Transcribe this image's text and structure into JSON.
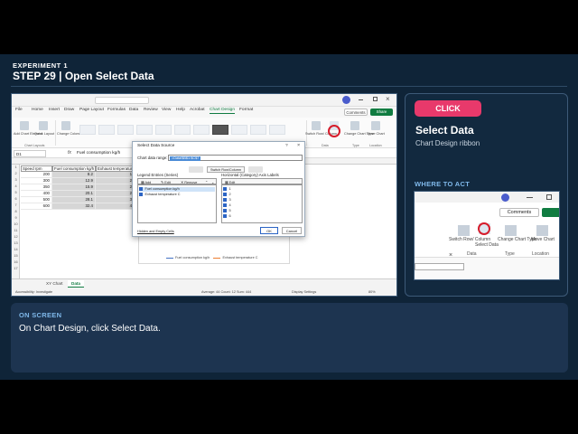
{
  "header": {
    "experiment": "EXPERIMENT 1",
    "step": "STEP 29  |  Open Select Data"
  },
  "excel": {
    "menus": [
      "File",
      "Home",
      "Insert",
      "Draw",
      "Page Layout",
      "Formulas",
      "Data",
      "Review",
      "View",
      "Help",
      "Acrobat",
      "Chart Design",
      "Format"
    ],
    "active_menu": "Chart Design",
    "comments": "Comments",
    "share": "Share",
    "ribbon": {
      "add_chart_element": "Add Chart Element",
      "quick_layout": "Quick Layout",
      "change_colors": "Change Colors",
      "switch_row_column": "Switch Row/ Column",
      "select_data": "Select Data",
      "change_chart_type": "Change Chart Type",
      "move_chart": "Move Chart",
      "group_chart_layouts": "Chart Layouts",
      "group_data": "Data",
      "group_type": "Type",
      "group_location": "Location"
    },
    "name_box": "D1",
    "formula": "Fuel consumption kg/h",
    "columns": [
      "Speed rpm",
      "Fuel consumption kg/h",
      "Exhaust temperature C"
    ],
    "rows": [
      [
        "200",
        "8.2",
        "190"
      ],
      [
        "300",
        "12.9",
        "235"
      ],
      [
        "350",
        "15.9",
        "255"
      ],
      [
        "400",
        "20.1",
        "280"
      ],
      [
        "500",
        "28.1",
        "330"
      ],
      [
        "600",
        "32.4",
        "400"
      ]
    ],
    "legend": [
      "Fuel consumption kg/h",
      "Exhaust temperature C"
    ],
    "sheet_tabs": [
      "XY Chart",
      "Data"
    ],
    "active_sheet": "Data",
    "status": {
      "accessibility": "Accessibility: Investigate",
      "average": "Average: 44  Count: 12  Sum: 444",
      "display": "Display Settings",
      "zoom": "80%"
    }
  },
  "dialog": {
    "title": "Select Data Source",
    "chart_range_label": "Chart data range:",
    "chart_range_value": "=Data!$B$1:$C$7",
    "switch_label": "Switch Row/Column",
    "legend_label": "Legend Entries (Series)",
    "axis_label": "Horizontal (Category) Axis Labels",
    "add": "Add",
    "edit": "Edit",
    "remove": "Remove",
    "edit2": "Edit",
    "series": [
      "Fuel consumption kg/h",
      "Exhaust temperature C"
    ],
    "categories": [
      "1",
      "2",
      "3",
      "4",
      "5",
      "6"
    ],
    "hidden_cells": "Hidden and Empty Cells",
    "ok": "OK",
    "cancel": "Cancel"
  },
  "card": {
    "badge": "CLICK",
    "title": "Select Data",
    "subtitle": "Chart Design ribbon",
    "where_label": "WHERE TO ACT",
    "crop": {
      "comments": "Comments",
      "switch": "Switch Row/ Column",
      "select_data": "Select Data",
      "change_chart_type": "Change Chart Type",
      "move_chart": "Move Chart",
      "group_data": "Data",
      "group_type": "Type",
      "group_location": "Location"
    }
  },
  "onscreen": {
    "label": "ON SCREEN",
    "text": "On Chart Design, click Select Data."
  },
  "colors": {
    "accent_pink": "#e8396b",
    "excel_green": "#107c41",
    "target_red": "#d61c2b",
    "label_blue": "#7fb8ea",
    "series1": "#4472c4",
    "series2": "#ed7d31"
  }
}
